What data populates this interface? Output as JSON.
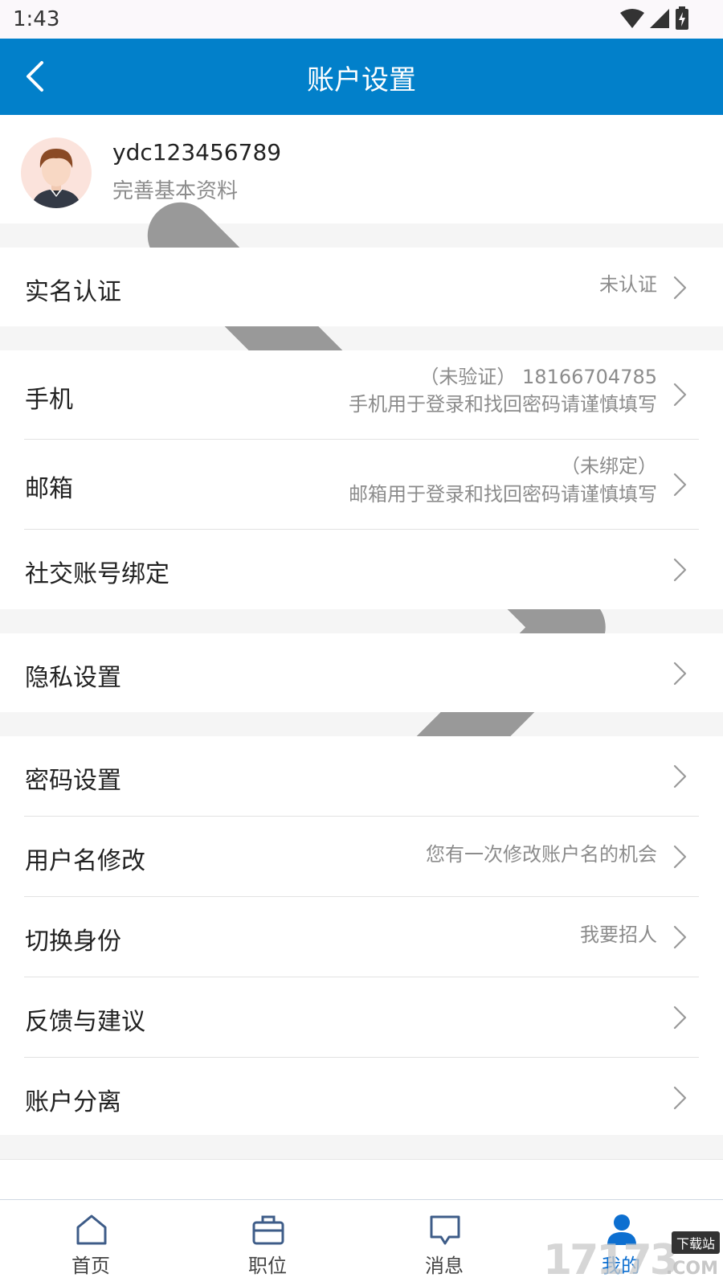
{
  "status_bar": {
    "time": "1:43"
  },
  "header": {
    "title": "账户设置"
  },
  "profile": {
    "username": "ydc123456789",
    "subtitle": "完善基本资料"
  },
  "rows": {
    "real_name": {
      "label": "实名认证",
      "value": "未认证"
    },
    "phone": {
      "label": "手机",
      "value_line1": "（未验证） 18166704785",
      "value_line2": "手机用于登录和找回密码请谨慎填写"
    },
    "email": {
      "label": "邮箱",
      "value_line1": "（未绑定）",
      "value_line2": "邮箱用于登录和找回密码请谨慎填写"
    },
    "social": {
      "label": "社交账号绑定"
    },
    "privacy": {
      "label": "隐私设置"
    },
    "password": {
      "label": "密码设置"
    },
    "username_change": {
      "label": "用户名修改",
      "value": "您有一次修改账户名的机会"
    },
    "switch_identity": {
      "label": "切换身份",
      "value": "我要招人"
    },
    "feedback": {
      "label": "反馈与建议"
    },
    "account_separation": {
      "label": "账户分离"
    }
  },
  "tabbar": {
    "tabs": [
      {
        "label": "首页",
        "icon": "home-icon",
        "active": false
      },
      {
        "label": "职位",
        "icon": "briefcase-icon",
        "active": false
      },
      {
        "label": "消息",
        "icon": "message-icon",
        "active": false
      },
      {
        "label": "我的",
        "icon": "person-icon",
        "active": true
      }
    ]
  },
  "watermark": {
    "text": "17173",
    "badge": "下载站",
    "suffix": ".COM"
  },
  "colors": {
    "primary": "#0280ca",
    "background": "#f5f5f5",
    "secondary_text": "#8c8c8c"
  }
}
